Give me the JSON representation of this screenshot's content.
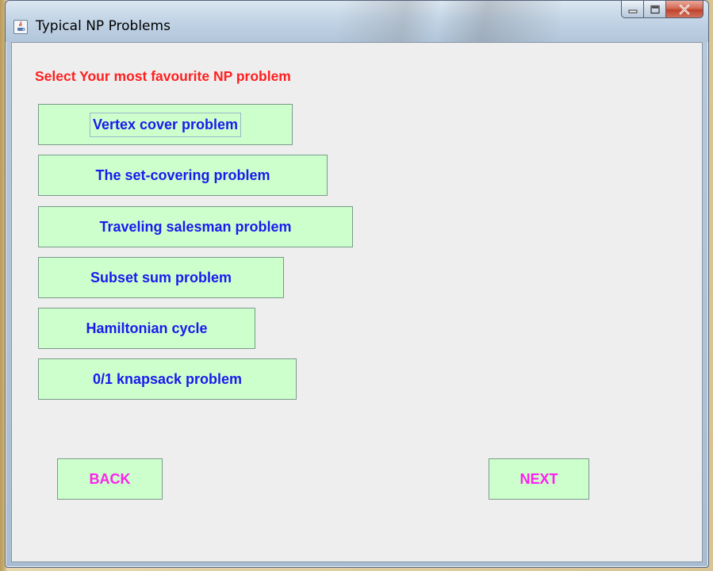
{
  "window": {
    "title": "Typical NP Problems",
    "icon": "java-cup-icon",
    "controls": [
      "minimize-icon",
      "maximize-icon",
      "close-icon"
    ]
  },
  "main": {
    "heading": "Select Your most favourite NP problem",
    "heading_color": "#ff1f1f",
    "problems": [
      {
        "label": "Vertex cover problem"
      },
      {
        "label": "The set-covering problem"
      },
      {
        "label": "Traveling salesman problem"
      },
      {
        "label": "Subset sum problem"
      },
      {
        "label": "Hamiltonian cycle"
      },
      {
        "label": "0/1 knapsack problem"
      }
    ],
    "button_bg": "#ccffcc",
    "button_text_color": "#1a1aee"
  },
  "navigation": {
    "back_label": "BACK",
    "next_label": "NEXT",
    "text_color": "#ff1ff0"
  }
}
